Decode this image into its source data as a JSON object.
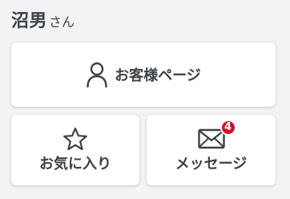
{
  "header": {
    "user_name": "沼男",
    "honorific": "さん"
  },
  "cards": {
    "account": {
      "label": "お客様ページ",
      "icon": "person-icon"
    },
    "favorites": {
      "label": "お気に入り",
      "icon": "star-icon"
    },
    "messages": {
      "label": "メッセージ",
      "icon": "envelope-icon",
      "badge_count": "4"
    }
  },
  "colors": {
    "text": "#3c4146",
    "background": "#f2f3f5",
    "card": "#ffffff",
    "badge": "#d0112b"
  }
}
